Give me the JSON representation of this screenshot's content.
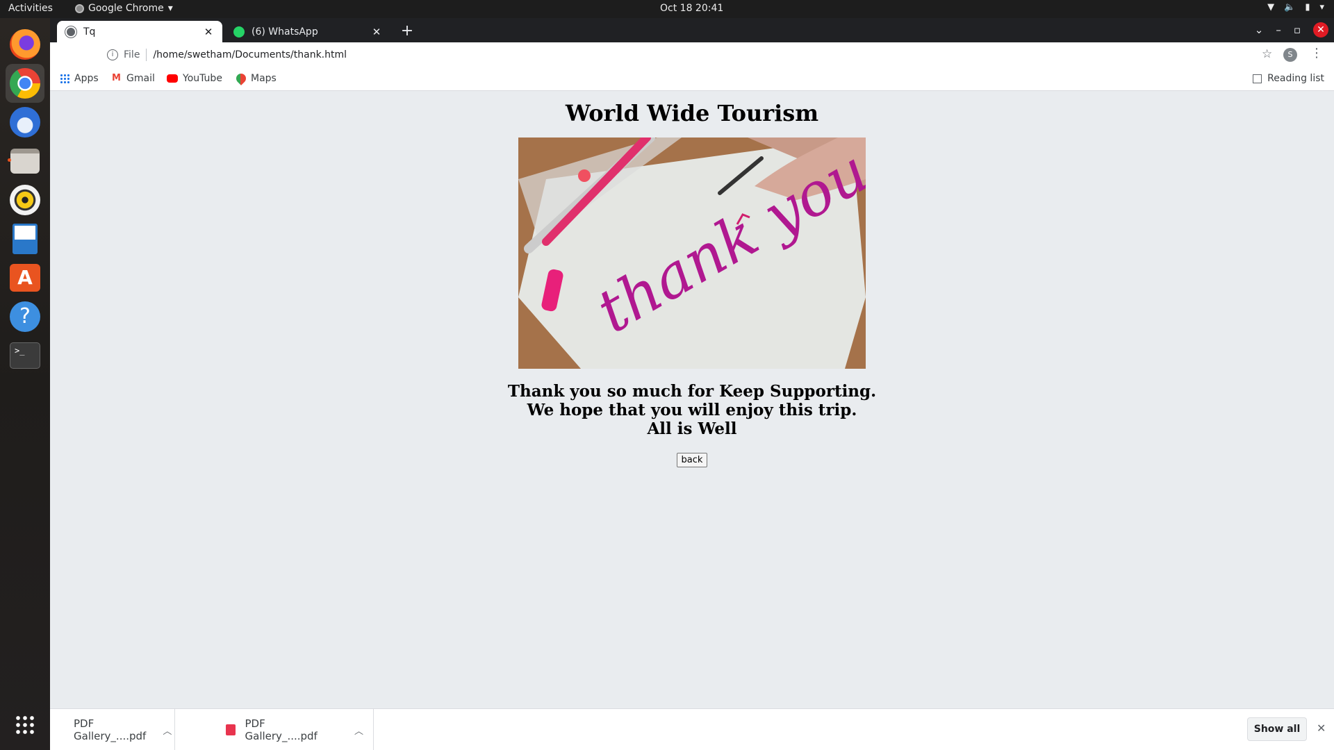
{
  "system": {
    "activities": "Activities",
    "app_menu": "Google Chrome",
    "clock": "Oct 18  20:41"
  },
  "tabs": [
    {
      "title": "Tq"
    },
    {
      "title": "(6) WhatsApp"
    }
  ],
  "toolbar": {
    "scheme": "File",
    "url": "/home/swetham/Documents/thank.html",
    "profile_initial": "S"
  },
  "bookmarks": {
    "items": [
      "Apps",
      "Gmail",
      "YouTube",
      "Maps"
    ],
    "reading_list": "Reading list"
  },
  "page": {
    "title": "World Wide Tourism",
    "image_text": "thank you",
    "lines": [
      "Thank you so much for Keep Supporting.",
      "We hope that you will enjoy this trip.",
      "All is Well"
    ],
    "back_label": "back"
  },
  "downloads": {
    "items": [
      "PDF Gallery_....pdf",
      "PDF Gallery_....pdf"
    ],
    "show_all": "Show all"
  },
  "colors": {
    "brand_orange": "#e95420",
    "close_red": "#e01b24",
    "pdf_red": "#e8344e"
  },
  "icons": {
    "dock": [
      "firefox-icon",
      "chrome-icon",
      "thunderbird-icon",
      "files-icon",
      "rhythmbox-icon",
      "writer-icon",
      "software-icon",
      "help-icon",
      "terminal-icon",
      "app-grid-icon"
    ]
  }
}
